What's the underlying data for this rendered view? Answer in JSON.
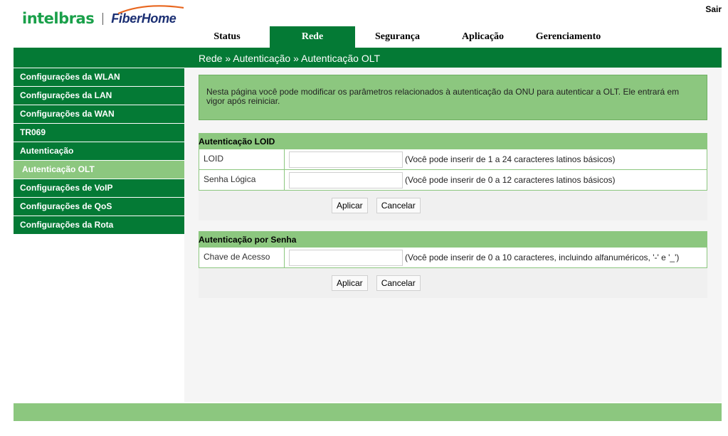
{
  "header": {
    "brand_intelbras": "intelbras",
    "brand_fiberhome": "FiberHome",
    "logout": "Sair"
  },
  "top_nav": [
    {
      "label": "Status",
      "active": false
    },
    {
      "label": "Rede",
      "active": true
    },
    {
      "label": "Segurança",
      "active": false
    },
    {
      "label": "Aplicação",
      "active": false
    },
    {
      "label": "Gerenciamento",
      "active": false
    }
  ],
  "breadcrumb": "Rede » Autenticação » Autenticação OLT",
  "sidebar": {
    "items": [
      {
        "label": "Configurações da WLAN",
        "active": false
      },
      {
        "label": "Configurações da LAN",
        "active": false
      },
      {
        "label": "Configurações da WAN",
        "active": false
      },
      {
        "label": "TR069",
        "active": false
      },
      {
        "label": "Autenticação",
        "active": false
      },
      {
        "label": "Autenticação OLT",
        "active": true
      },
      {
        "label": "Configurações de VoIP",
        "active": false
      },
      {
        "label": "Configurações de QoS",
        "active": false
      },
      {
        "label": "Configurações da Rota",
        "active": false
      }
    ]
  },
  "info_text": "Nesta página você pode modificar os parâmetros relacionados à autenticação da ONU para autenticar a OLT. Ele entrará em vigor após reiniciar.",
  "loid_section": {
    "title": "Autenticação LOID",
    "loid_label": "LOID",
    "loid_value": "",
    "loid_hint": "(Você pode inserir de 1 a 24 caracteres latinos básicos)",
    "password_label": "Senha Lógica",
    "password_value": "",
    "password_hint": "(Você pode inserir de 0 a 12 caracteres latinos básicos)",
    "apply_label": "Aplicar",
    "cancel_label": "Cancelar"
  },
  "password_section": {
    "title": "Autenticação por Senha",
    "key_label": "Chave de Acesso",
    "key_value": "",
    "key_hint": "(Você pode inserir de 0 a 10 caracteres, incluindo alfanuméricos, '-' e '_')",
    "apply_label": "Aplicar",
    "cancel_label": "Cancelar"
  },
  "colors": {
    "primary_green": "#047a35",
    "light_green": "#8cc77f",
    "intelbras_green": "#1aa04a",
    "fiberhome_blue": "#1b2f73",
    "fiberhome_orange": "#e8661e"
  }
}
